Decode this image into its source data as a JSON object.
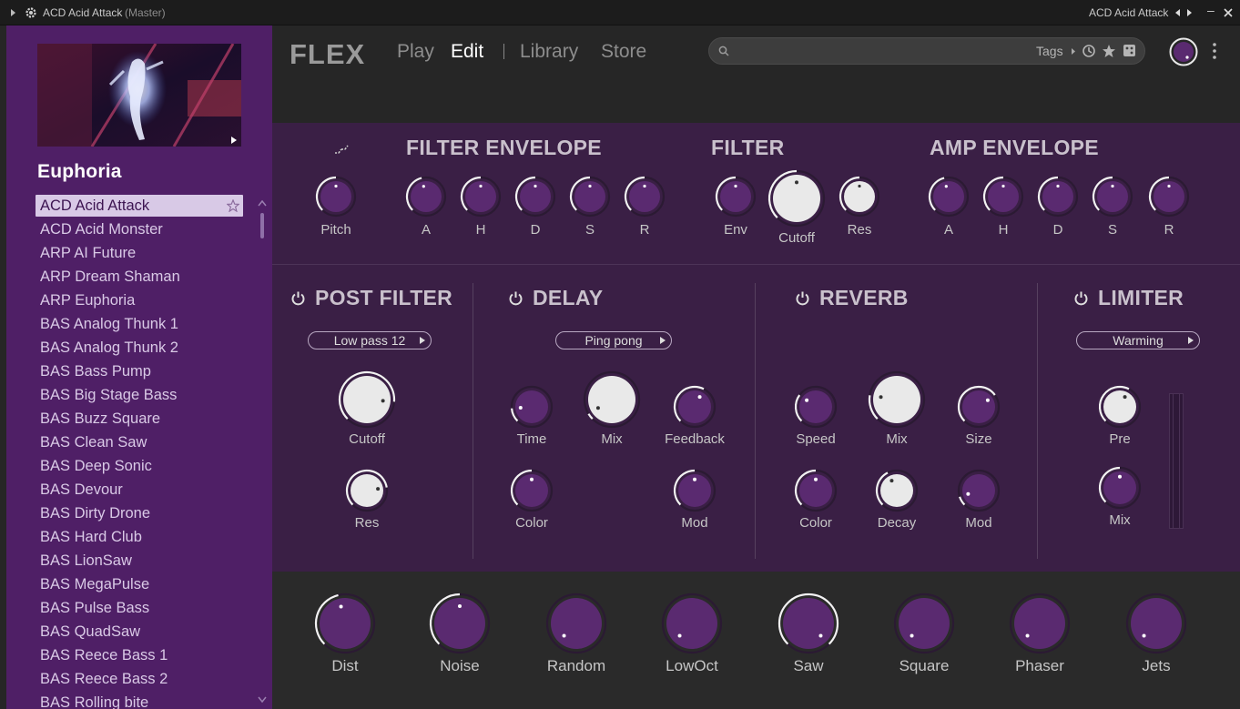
{
  "titlebar": {
    "title": "ACD Acid Attack",
    "subtitle": "(Master)",
    "right_preset": "ACD Acid Attack",
    "minimize": "–"
  },
  "sidebar": {
    "preset_name": "Euphoria",
    "presets": [
      "ACD Acid Attack",
      "ACD Acid Monster",
      "ARP AI Future",
      "ARP Dream Shaman",
      "ARP Euphoria",
      "BAS Analog Thunk 1",
      "BAS Analog Thunk 2",
      "BAS Bass Pump",
      "BAS Big Stage Bass",
      "BAS Buzz Square",
      "BAS Clean Saw",
      "BAS Deep Sonic",
      "BAS Devour",
      "BAS Dirty Drone",
      "BAS Hard Club",
      "BAS LionSaw",
      "BAS MegaPulse",
      "BAS Pulse Bass",
      "BAS QuadSaw",
      "BAS Reece Bass 1",
      "BAS Reece Bass 2",
      "BAS Rolling bite"
    ],
    "selected_index": 0
  },
  "header": {
    "logo": "FLEX",
    "nav": {
      "play": "Play",
      "edit": "Edit",
      "library": "Library",
      "store": "Store"
    },
    "search": {
      "placeholder": "",
      "tags": "Tags"
    }
  },
  "envelopes": {
    "filter_envelope_title": "FILTER ENVELOPE",
    "filter_title": "FILTER",
    "amp_envelope_title": "AMP ENVELOPE",
    "pitch_label": "Pitch",
    "filter_env_labels": [
      "A",
      "H",
      "D",
      "S",
      "R"
    ],
    "filter_labels": {
      "env": "Env",
      "cutoff": "Cutoff",
      "res": "Res"
    },
    "amp_env_labels": [
      "A",
      "H",
      "D",
      "S",
      "R"
    ]
  },
  "effects": {
    "post_filter": {
      "title": "POST FILTER",
      "mode": "Low pass 12",
      "cutoff": "Cutoff",
      "res": "Res"
    },
    "delay": {
      "title": "DELAY",
      "mode": "Ping pong",
      "time": "Time",
      "mix": "Mix",
      "feedback": "Feedback",
      "color": "Color",
      "mod": "Mod"
    },
    "reverb": {
      "title": "REVERB",
      "speed": "Speed",
      "mix": "Mix",
      "size": "Size",
      "color": "Color",
      "decay": "Decay",
      "mod": "Mod"
    },
    "limiter": {
      "title": "LIMITER",
      "mode": "Warming",
      "pre": "Pre",
      "mix": "Mix"
    }
  },
  "macros": [
    "Dist",
    "Noise",
    "Random",
    "LowOct",
    "Saw",
    "Square",
    "Phaser",
    "Jets"
  ],
  "colors": {
    "accent": "#4f1f66",
    "panel": "#3a1f45",
    "knob_purple": "#5a2a70",
    "knob_white": "#e6e6e6",
    "edit_active": "#ffffff"
  }
}
